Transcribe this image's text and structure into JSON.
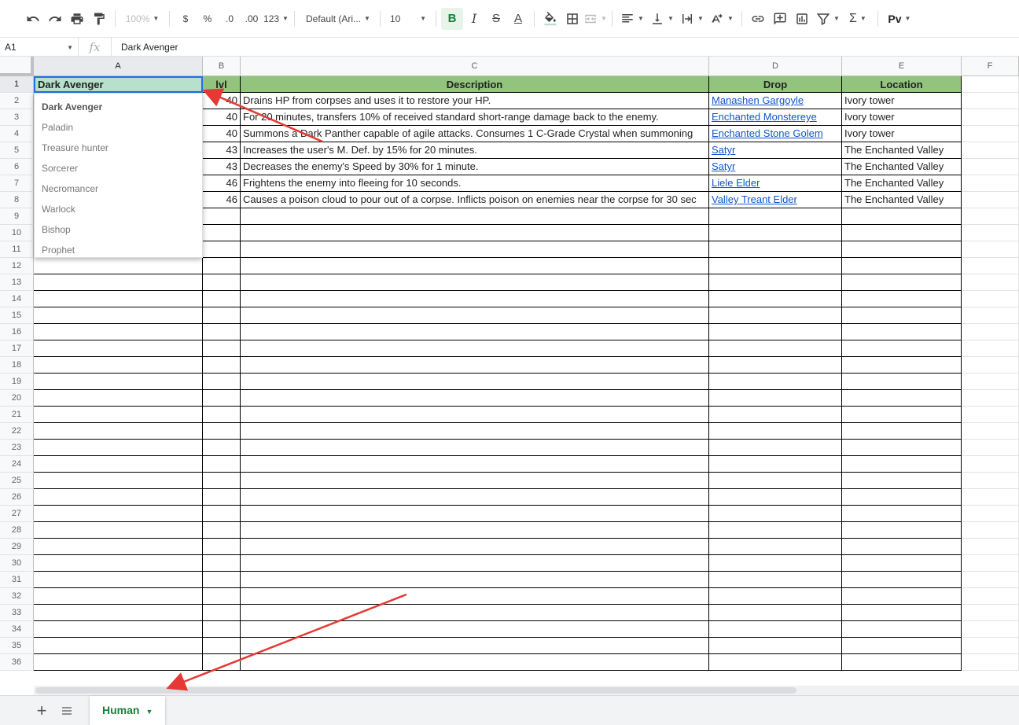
{
  "toolbar": {
    "zoom": "100%",
    "currency": "$",
    "percent": "%",
    "decrease_decimals": ".0",
    "increase_decimals": ".00",
    "more_formats": "123",
    "font_family": "Default (Ari...",
    "font_size": "10",
    "bold": "B",
    "text_color": "A",
    "script_addon": "Pv"
  },
  "formula_bar": {
    "name_box": "A1",
    "fx": "fx",
    "value": "Dark Avenger"
  },
  "columns": [
    "A",
    "B",
    "C",
    "D",
    "E",
    "F"
  ],
  "header_row": [
    "Dark Avenger",
    "lvl",
    "Description",
    "Drop",
    "Location"
  ],
  "rows": [
    {
      "level": "40",
      "description": "Drains HP from corpses and uses it to restore your HP.",
      "drop": "Manashen Gargoyle",
      "location": "Ivory tower"
    },
    {
      "level": "40",
      "description": "For 20 minutes, transfers 10% of received standard short-range damage back to the enemy.",
      "drop": "Enchanted Monstereye",
      "location": "Ivory tower"
    },
    {
      "level": "40",
      "description": "Summons a Dark Panther capable of agile attacks. Consumes 1 C-Grade Crystal when summoning",
      "drop": "Enchanted Stone Golem",
      "location": "Ivory tower"
    },
    {
      "level": "43",
      "description": "Increases the user's M. Def. by 15% for 20 minutes.",
      "drop": "Satyr",
      "location": "The Enchanted Valley"
    },
    {
      "level": "43",
      "description": "Decreases the enemy's Speed by 30% for 1 minute.",
      "drop": "Satyr",
      "location": "The Enchanted Valley"
    },
    {
      "level": "46",
      "description": "Frightens the enemy into fleeing for 10 seconds.",
      "drop": "Liele Elder",
      "location": "The Enchanted Valley"
    },
    {
      "level": "46",
      "description": "Causes a poison cloud to pour out of a corpse. Inflicts poison on enemies near the corpse for 30 sec",
      "drop": "Valley Treant Elder",
      "location": "The Enchanted Valley"
    }
  ],
  "row_numbers": [
    "1",
    "2",
    "3",
    "4",
    "5",
    "6",
    "7",
    "8",
    "9",
    "10",
    "11",
    "12",
    "13",
    "14",
    "15",
    "16",
    "17",
    "18",
    "19",
    "20",
    "21",
    "22",
    "23",
    "24",
    "25",
    "26",
    "27",
    "28",
    "29",
    "30",
    "31",
    "32",
    "33",
    "34",
    "35",
    "36"
  ],
  "dropdown": {
    "selected": "Dark Avenger",
    "options": [
      "Dark Avenger",
      "Paladin",
      "Treasure hunter",
      "Sorcerer",
      "Necromancer",
      "Warlock",
      "Bishop",
      "Prophet"
    ]
  },
  "sheets": [
    {
      "name": "Human",
      "active": true
    }
  ],
  "colors": {
    "header_fill": "#93c47d",
    "selected_cell_fill": "#b7e1cd",
    "link": "#1155cc",
    "active_tab": "#188038",
    "annotation_arrow": "#e53935"
  }
}
